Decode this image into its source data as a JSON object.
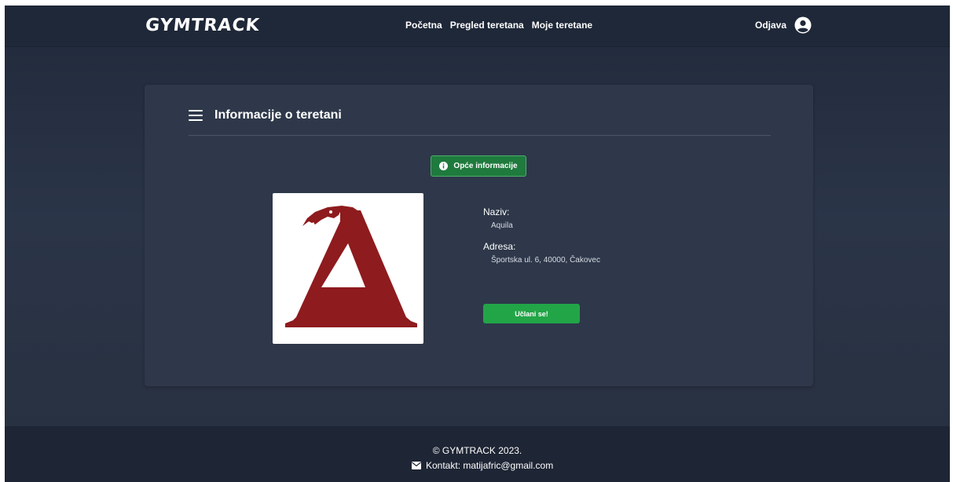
{
  "navbar": {
    "brand": "GYMTRACK",
    "links": [
      "Početna",
      "Pregled teretana",
      "Moje teretane"
    ],
    "logout": "Odjava",
    "user_icon": "user-circle-icon"
  },
  "card": {
    "title": "Informacije o teretani",
    "menu_icon": "hamburger-icon",
    "info_button": "Opće informacije",
    "info_icon": "info-circle-icon",
    "fields": [
      {
        "label": "Naziv:",
        "value": "Aquila"
      },
      {
        "label": "Adresa:",
        "value": "Športska ul. 6, 40000, Čakovec"
      }
    ],
    "join_button": "Učlani se!",
    "logo_letter": "A",
    "logo_color": "#8e1b1e"
  },
  "footer": {
    "copyright": "© GYMTRACK 2023.",
    "contact": "Kontakt: matijafric@gmail.com",
    "mail_icon": "envelope-icon"
  },
  "colors": {
    "accent_green": "#22a547",
    "background": "#2b3548"
  }
}
